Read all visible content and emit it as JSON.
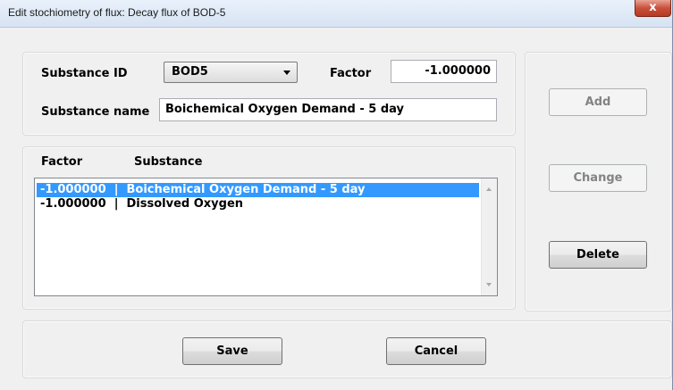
{
  "window": {
    "title": "Edit stochiometry of flux: Decay flux of BOD-5",
    "close_label": "x"
  },
  "form": {
    "substance_id_label": "Substance ID",
    "substance_id_value": "BOD5",
    "factor_label": "Factor",
    "factor_value": "-1.000000",
    "substance_name_label": "Substance name",
    "substance_name_value": "Boichemical Oxygen Demand - 5 day"
  },
  "list": {
    "header_factor": "Factor",
    "header_substance": "Substance",
    "rows": [
      {
        "text": "-1.000000  |  Boichemical Oxygen Demand - 5 day",
        "selected": true
      },
      {
        "text": "-1.000000  |  Dissolved Oxygen",
        "selected": false
      }
    ]
  },
  "side_buttons": {
    "add": "Add",
    "change": "Change",
    "delete": "Delete"
  },
  "footer": {
    "save": "Save",
    "cancel": "Cancel"
  },
  "colors": {
    "selection": "#3399ff",
    "close_button": "#c9503a"
  }
}
